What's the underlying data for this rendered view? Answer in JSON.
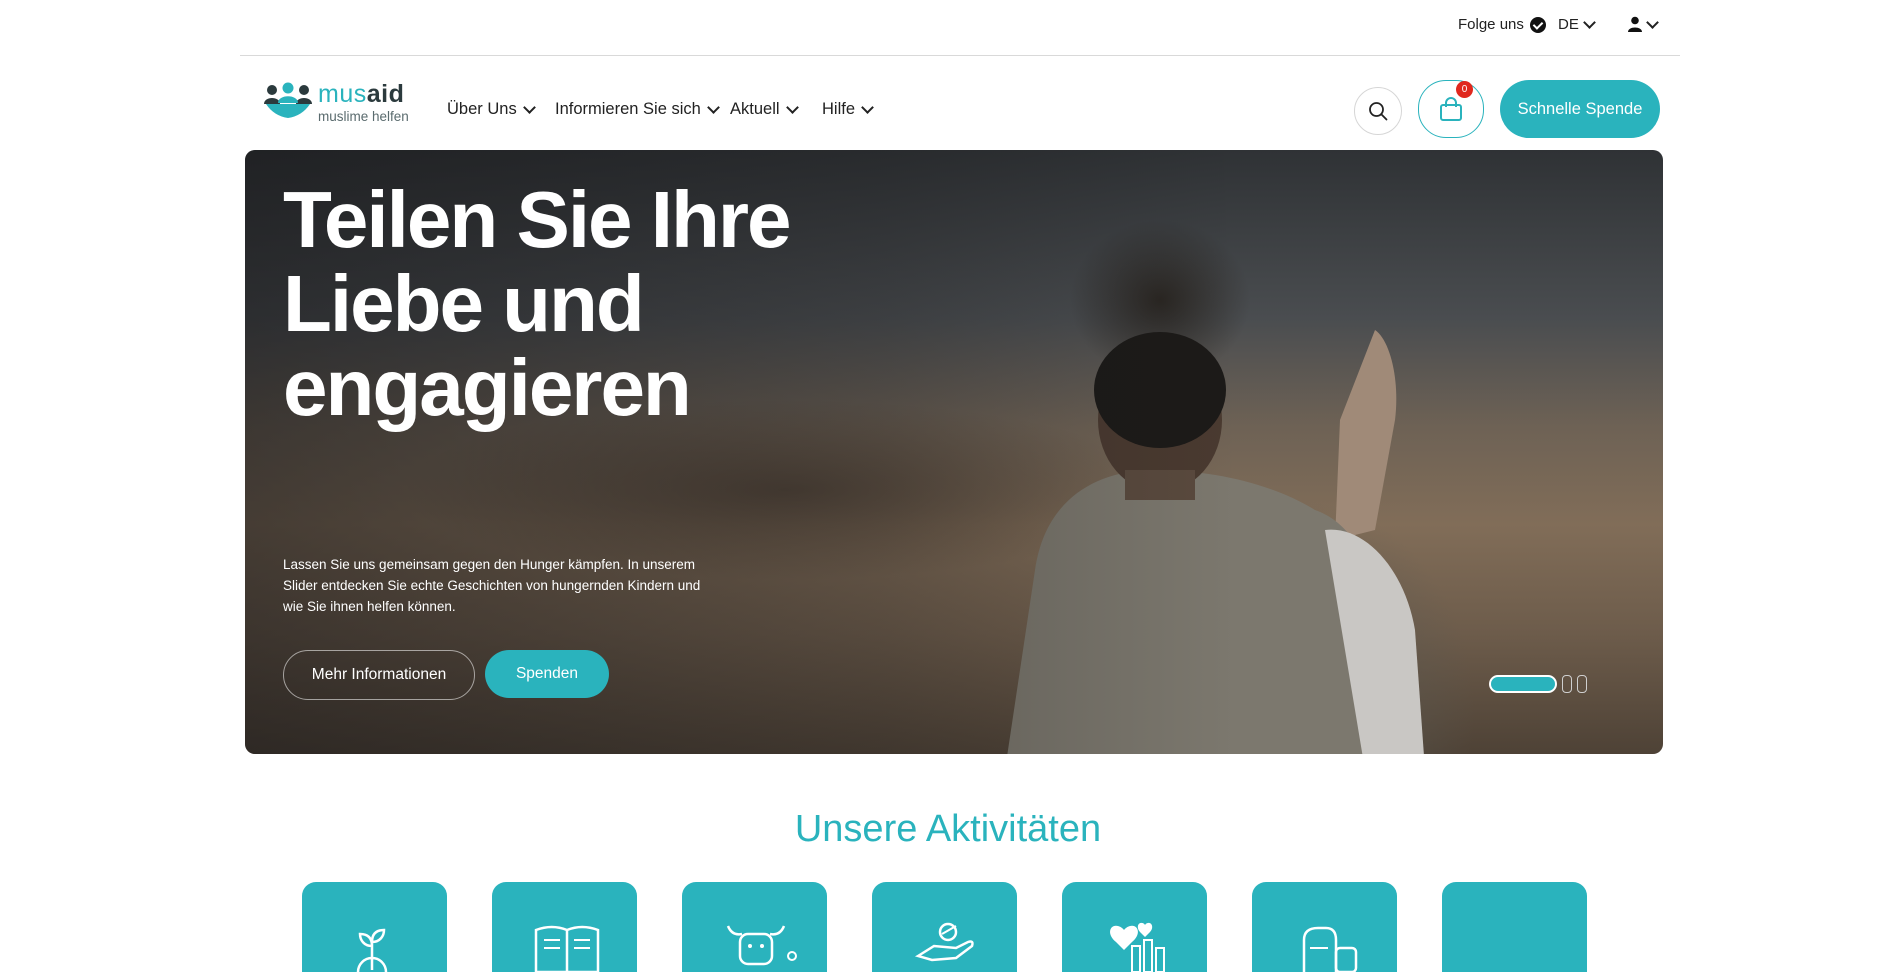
{
  "topbar": {
    "follow_label": "Folge uns",
    "lang_label": "DE",
    "follow_icon": "verified-icon",
    "user_icon": "user-icon"
  },
  "header": {
    "logo_brand_1": "mus",
    "logo_brand_2": "aid",
    "logo_tagline": "muslime helfen",
    "menu": [
      {
        "label": "Über Uns"
      },
      {
        "label": "Informieren Sie sich"
      },
      {
        "label": "Aktuell"
      },
      {
        "label": "Hilfe"
      }
    ],
    "cart_count": "0",
    "quick_donate_label": "Schnelle Spende",
    "accent_color": "#2ab3bd"
  },
  "hero": {
    "title": "Teilen Sie Ihre Liebe und engagieren",
    "description": "Lassen Sie uns gemeinsam gegen den Hunger kämpfen. In unserem Slider entdecken Sie echte Geschichten von hungernden Kindern und wie Sie ihnen helfen können.",
    "more_button": "Mehr Informationen",
    "donate_button": "Spenden",
    "slides_total": 3,
    "active_slide": 1
  },
  "activities": {
    "title": "Unsere Aktivitäten",
    "cards": [
      {
        "icon": "sapling-icon"
      },
      {
        "icon": "book-icon"
      },
      {
        "icon": "cow-icon"
      },
      {
        "icon": "giving-hand-icon"
      },
      {
        "icon": "hearts-icon"
      },
      {
        "icon": "water-tank-icon"
      },
      {
        "icon": "blank-icon"
      }
    ]
  }
}
